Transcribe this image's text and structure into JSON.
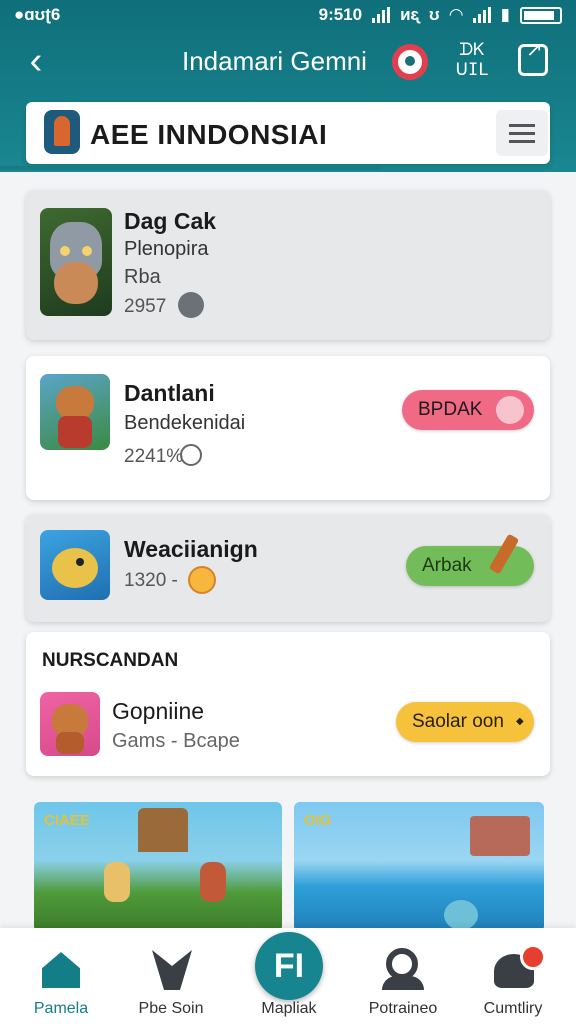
{
  "status_bar": {
    "left_text": "●ɑʊʈ6",
    "time": "9:510",
    "carrier": "ᴎᶓ"
  },
  "header": {
    "title": "Indamari Gemni",
    "qr_text_line1": "ᗪᏦ",
    "qr_text_line2": "ᑌIL"
  },
  "search": {
    "text": "AEE INNDONSIAI"
  },
  "cards": [
    {
      "title": "Dag Cak",
      "subtitle": "Plenopira",
      "tag": "Rba",
      "meta": "2957"
    },
    {
      "title": "Dantlani",
      "subtitle": "Bendekenidai",
      "meta": "2241%",
      "button": "BPDAK"
    },
    {
      "title": "Weaciianign",
      "meta": "1320 -",
      "button": "Arbak"
    },
    {
      "section_title": "NURSCANDAN",
      "title": "Gopniine",
      "subtitle": "Gams - Bcape",
      "button": "Saolar oon"
    }
  ],
  "banners": {
    "left_label": "CIAEE",
    "right_label": "OIG"
  },
  "bottom_nav": {
    "items": [
      {
        "label": "Pamela"
      },
      {
        "label": "Pbe Soin"
      },
      {
        "label": "Mapliak",
        "fab_text": "FI"
      },
      {
        "label": "Potraineo"
      },
      {
        "label": "Cumtliry"
      }
    ]
  },
  "colors": {
    "header_teal": "#137d88",
    "pill_pink": "#f06a86",
    "pill_green": "#72bd5a",
    "pill_yellow": "#f6c23c",
    "notification_red": "#e5402f"
  }
}
